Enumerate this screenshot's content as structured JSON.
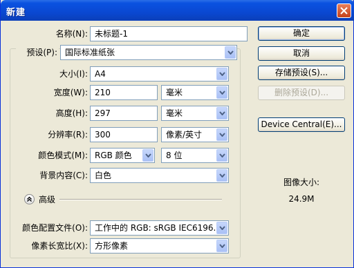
{
  "window": {
    "title": "新建"
  },
  "form": {
    "name_label": "名称(N):",
    "name_value": "未标题-1",
    "preset_label": "预设(P):",
    "preset_value": "国际标准纸张",
    "size_label": "大小(I):",
    "size_value": "A4",
    "width_label": "宽度(W):",
    "width_value": "210",
    "width_unit": "毫米",
    "height_label": "高度(H):",
    "height_value": "297",
    "height_unit": "毫米",
    "resolution_label": "分辨率(R):",
    "resolution_value": "300",
    "resolution_unit": "像素/英寸",
    "color_mode_label": "颜色模式(M):",
    "color_mode_value": "RGB 颜色",
    "bit_depth_value": "8 位",
    "background_label": "背景内容(C):",
    "background_value": "白色",
    "advanced_label": "高级",
    "color_profile_label": "颜色配置文件(O):",
    "color_profile_value": "工作中的 RGB: sRGB IEC6196...",
    "pixel_aspect_label": "像素长宽比(X):",
    "pixel_aspect_value": "方形像素"
  },
  "buttons": {
    "ok": "确定",
    "cancel": "取消",
    "save_preset": "存储预设(S)...",
    "delete_preset": "删除预设(D)...",
    "device_central": "Device Central(E)..."
  },
  "info": {
    "image_size_label": "图像大小:",
    "image_size_value": "24.9M"
  },
  "icons": {
    "close": "close-icon",
    "dropdown": "chevron-down-icon",
    "collapse": "double-chevron-up-icon"
  }
}
